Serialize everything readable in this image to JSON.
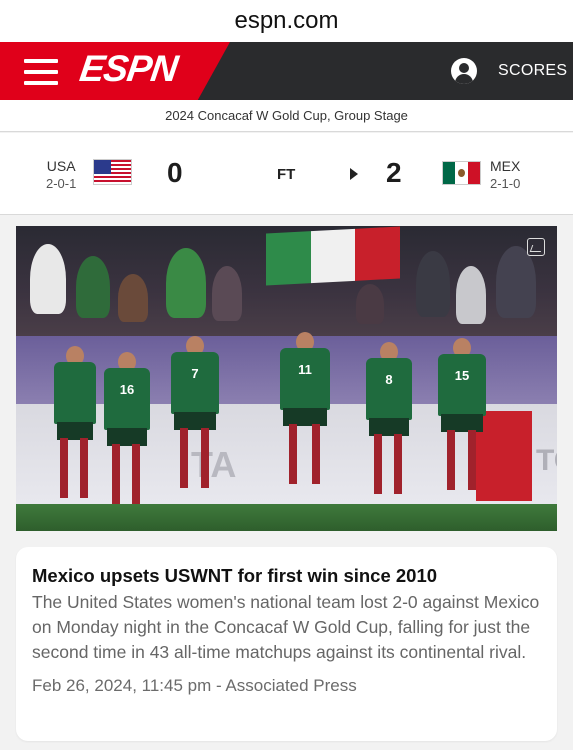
{
  "browser": {
    "url": "espn.com"
  },
  "nav": {
    "logo": "ESPN",
    "scores_label": "SCORES"
  },
  "event": {
    "title": "2024 Concacaf W Gold Cup, Group Stage"
  },
  "match": {
    "home": {
      "abbr": "USA",
      "record": "2-0-1",
      "score": "0"
    },
    "away": {
      "abbr": "MEX",
      "record": "2-1-0",
      "score": "2"
    },
    "status": "FT"
  },
  "story": {
    "headline": "Mexico upsets USWNT for first win since 2010",
    "description": "The United States women's national team lost 2-0 against Mexico on Monday night in the Concacaf W Gold Cup, falling for just the second time in 43 all-time matchups against its continental rival.",
    "meta": "Feb 26, 2024, 11:45 pm - Associated Press"
  },
  "photo": {
    "jersey_numbers": [
      "16",
      "7",
      "11",
      "8",
      "15"
    ],
    "ad_text": "TA",
    "ad_text_right": "TO"
  },
  "colors": {
    "espn_red": "#e0001a",
    "nav_dark": "#2a2b2d",
    "mexico_green": "#1f6b3e"
  }
}
